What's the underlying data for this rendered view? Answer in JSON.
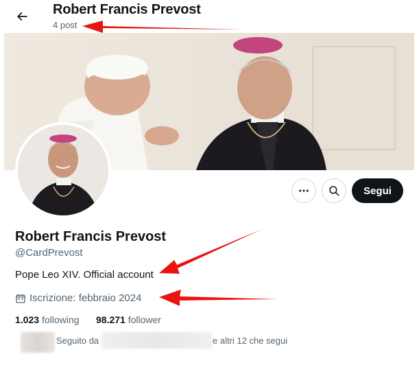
{
  "header": {
    "title": "Robert Francis Prevost",
    "post_count": "4 post"
  },
  "profile": {
    "display_name": "Robert Francis Prevost",
    "handle": "@CardPrevost",
    "bio": "Pope Leo XIV. Official account",
    "joined": "Iscrizione: febbraio 2024"
  },
  "actions": {
    "follow_label": "Segui"
  },
  "stats": {
    "following_count": "1.023",
    "following_label": "following",
    "followers_count": "98.271",
    "followers_label": "follower"
  },
  "followed_by": {
    "prefix": "Seguito da",
    "suffix": "e altri 12 che segui"
  },
  "icons": [
    "back-arrow-icon",
    "more-icon",
    "search-icon",
    "calendar-icon"
  ],
  "colors": {
    "text_primary": "#0f1419",
    "text_secondary": "#536471",
    "follow_button": "#0f1419",
    "annotation_arrow": "#e8140f"
  }
}
